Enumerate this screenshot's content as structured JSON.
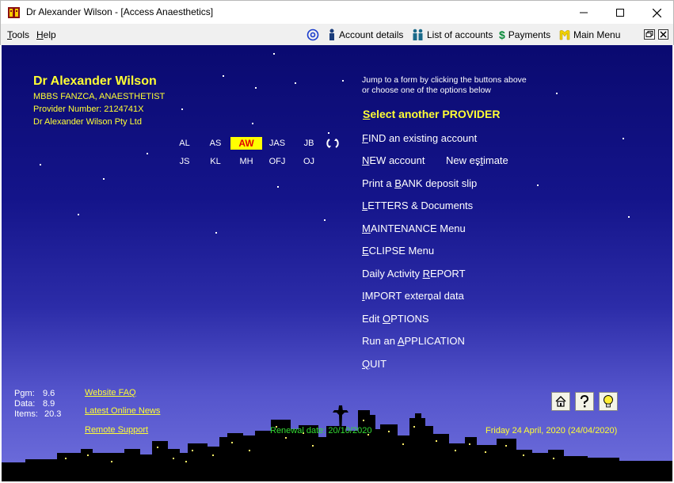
{
  "window": {
    "title": "Dr Alexander Wilson - [Access Anaesthetics]"
  },
  "menubar": {
    "tools": {
      "first": "T",
      "rest": "ools"
    },
    "help": {
      "first": "H",
      "rest": "elp"
    },
    "account_details": "Account details",
    "list_of_accounts": "List of accounts",
    "payments": "Payments",
    "main_menu": "Main Menu"
  },
  "provider": {
    "name": "Dr Alexander Wilson",
    "qualifications": "MBBS FANZCA, ANAESTHETIST",
    "provider_number": "Provider Number: 2124741X",
    "company": "Dr Alexander Wilson Pty Ltd"
  },
  "initials": {
    "row1": [
      "AL",
      "AS",
      "AW",
      "JAS",
      "JB"
    ],
    "row2": [
      "JS",
      "KL",
      "MH",
      "OFJ",
      "OJ"
    ],
    "selected": "AW"
  },
  "hints": {
    "line1": "Jump to a form by clicking the buttons above",
    "line2": "or choose one of the options below"
  },
  "options": {
    "select_provider": {
      "first": "S",
      "rest": "elect another PROVIDER"
    },
    "find": {
      "first": "F",
      "rest": "IND an existing account"
    },
    "new_account": {
      "first": "N",
      "rest": "EW account"
    },
    "new_estimate": {
      "before": "New es",
      "u": "t",
      "after": "imate"
    },
    "bank": {
      "before": "Print a ",
      "u": "B",
      "after": "ANK deposit slip"
    },
    "letters": {
      "first": "L",
      "rest": "ETTERS & Documents"
    },
    "maintenance": {
      "first": "M",
      "rest": "AINTENANCE Menu"
    },
    "eclipse": {
      "first": "E",
      "rest": "CLIPSE Menu"
    },
    "daily": {
      "before": "Daily Activity ",
      "u": "R",
      "after": "EPORT"
    },
    "import": {
      "first": "I",
      "rest": "MPORT external data"
    },
    "edit": {
      "before": "Edit ",
      "u": "O",
      "after": "PTIONS"
    },
    "run": {
      "before": "Run an ",
      "u": "A",
      "after": "PPLICATION"
    },
    "quit": {
      "first": "Q",
      "rest": "UIT"
    }
  },
  "stats": {
    "pgm_label": "Pgm:",
    "pgm_value": "9.6",
    "data_label": "Data:",
    "data_value": "8.9",
    "items_label": "Items:",
    "items_value": "20.3"
  },
  "links": {
    "faq": "Website FAQ",
    "news": "Latest Online News",
    "support": "Remote Support"
  },
  "footer": {
    "renewal": "Renewal date: 20/10/2020",
    "date": "Friday  24 April, 2020 (24/04/2020)"
  },
  "colors": {
    "accent_yellow": "#ffff33",
    "renewal_green": "#33dd33",
    "selected_bg": "#ffff00",
    "selected_text": "#e00000"
  }
}
